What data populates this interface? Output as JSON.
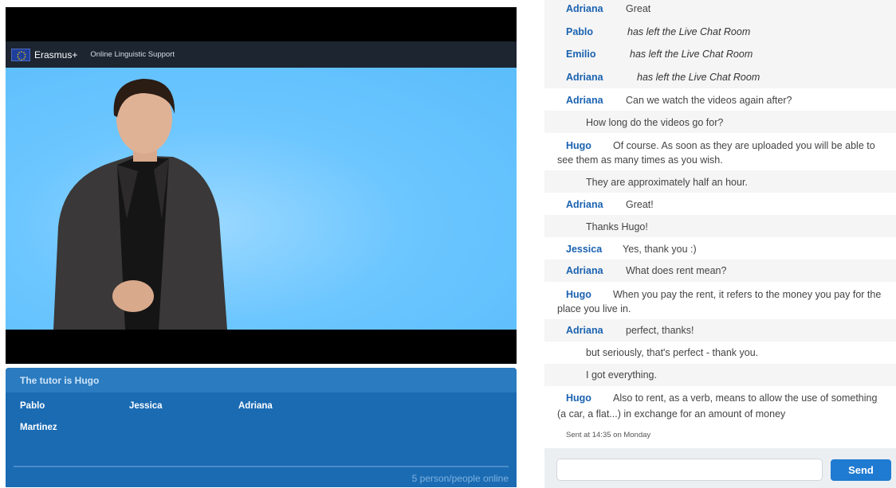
{
  "brand": {
    "name": "Erasmus+",
    "subtitle": "Online Linguistic Support"
  },
  "participants": {
    "tutor_label": "The tutor is Hugo",
    "people": [
      "Pablo",
      "Jessica",
      "Adriana",
      "Martinez"
    ],
    "online_count": "5 person/people online"
  },
  "chat": {
    "messages": [
      {
        "author": "Adriana",
        "text": "Great",
        "style": "message"
      },
      {
        "author": "Pablo",
        "text": "has left the Live Chat Room",
        "style": "leave"
      },
      {
        "author": "Emilio",
        "text": "has left the Live Chat Room",
        "style": "leave"
      },
      {
        "author": "Adriana",
        "text": "has left the Live Chat Room",
        "style": "leave"
      },
      {
        "author": "Adriana",
        "text": "Can we watch the videos again after?",
        "style": "message"
      },
      {
        "author": "",
        "text": "How long do the videos go for?",
        "style": "continuation"
      },
      {
        "author": "Hugo",
        "text": "Of course. As soon as they are uploaded you will be able to",
        "text2": "see them as many times as you wish.",
        "style": "message"
      },
      {
        "author": "",
        "text": "They are approximately half an hour.",
        "style": "continuation"
      },
      {
        "author": "Adriana",
        "text": "Great!",
        "style": "message"
      },
      {
        "author": "",
        "text": "Thanks Hugo!",
        "style": "continuation"
      },
      {
        "author": "Jessica",
        "text": "Yes, thank you :)",
        "style": "message"
      },
      {
        "author": "Adriana",
        "text": "What does rent mean?",
        "style": "message"
      },
      {
        "author": "Hugo",
        "text": "When you pay the rent, it refers to the money you pay for the",
        "text2": "place you live in.",
        "style": "message"
      },
      {
        "author": "Adriana",
        "text": "perfect, thanks!",
        "style": "message"
      },
      {
        "author": "",
        "text": "but seriously, that's perfect - thank you.",
        "style": "continuation"
      },
      {
        "author": "",
        "text": "I got everything.",
        "style": "continuation"
      },
      {
        "author": "Hugo",
        "text": "Also to rent, as a verb, means to allow the use of something",
        "text2": "(a car, a flat...) in exchange for an amount of money",
        "style": "message"
      }
    ],
    "sent_info": "Sent at 14:35 on Monday"
  },
  "composer": {
    "input_value": "",
    "input_placeholder": "",
    "send_label": "Send"
  },
  "colors": {
    "accent": "#1f7ad1",
    "author": "#1a62b0",
    "panel": "#1b6bb3",
    "stage": "#5bbdfb"
  }
}
